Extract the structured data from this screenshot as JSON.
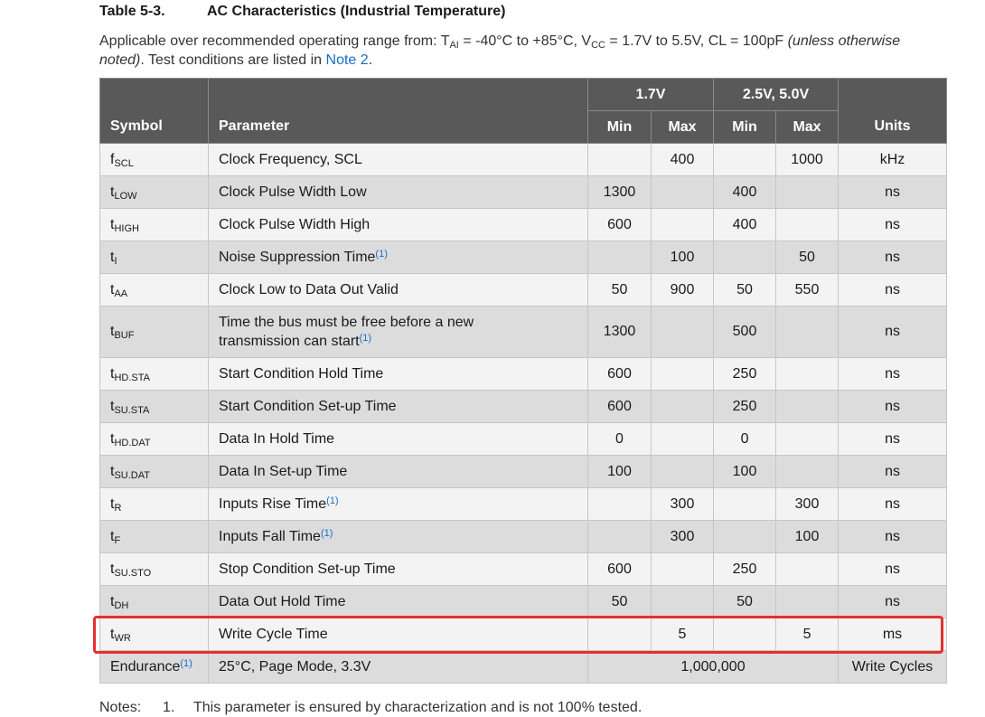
{
  "caption": {
    "number": "Table 5-3.",
    "title": "AC Characteristics (Industrial Temperature)"
  },
  "intro": {
    "p1": "Applicable over recommended operating range from: T",
    "ta_sub": "AI",
    "p2": " = -40°C to +85°C, V",
    "vcc_sub": "CC",
    "p3": " = 1.7V to 5.5V, CL = 100pF ",
    "italic": "(unless otherwise noted)",
    "p4": ". Test conditions are listed in ",
    "link": "Note 2",
    "p5": "."
  },
  "header": {
    "symbol": "Symbol",
    "parameter": "Parameter",
    "group1": "1.7V",
    "group2": "2.5V, 5.0V",
    "min": "Min",
    "max": "Max",
    "units": "Units"
  },
  "rows": [
    {
      "sym": "f",
      "sub": "SCL",
      "param": "Clock Frequency, SCL",
      "note": "",
      "min1": "",
      "max1": "400",
      "min2": "",
      "max2": "1000",
      "units": "kHz"
    },
    {
      "sym": "t",
      "sub": "LOW",
      "param": "Clock Pulse Width Low",
      "note": "",
      "min1": "1300",
      "max1": "",
      "min2": "400",
      "max2": "",
      "units": "ns"
    },
    {
      "sym": "t",
      "sub": "HIGH",
      "param": "Clock Pulse Width High",
      "note": "",
      "min1": "600",
      "max1": "",
      "min2": "400",
      "max2": "",
      "units": "ns"
    },
    {
      "sym": "t",
      "sub": "I",
      "param": "Noise Suppression Time",
      "note": "(1)",
      "min1": "",
      "max1": "100",
      "min2": "",
      "max2": "50",
      "units": "ns"
    },
    {
      "sym": "t",
      "sub": "AA",
      "param": "Clock Low to Data Out Valid",
      "note": "",
      "min1": "50",
      "max1": "900",
      "min2": "50",
      "max2": "550",
      "units": "ns"
    },
    {
      "sym": "t",
      "sub": "BUF",
      "param_line1": "Time the bus must be free before a new",
      "param": "transmission can start",
      "note": "(1)",
      "min1": "1300",
      "max1": "",
      "min2": "500",
      "max2": "",
      "units": "ns"
    },
    {
      "sym": "t",
      "sub": "HD.STA",
      "param": "Start Condition Hold Time",
      "note": "",
      "min1": "600",
      "max1": "",
      "min2": "250",
      "max2": "",
      "units": "ns"
    },
    {
      "sym": "t",
      "sub": "SU.STA",
      "param": "Start Condition Set-up Time",
      "note": "",
      "min1": "600",
      "max1": "",
      "min2": "250",
      "max2": "",
      "units": "ns"
    },
    {
      "sym": "t",
      "sub": "HD.DAT",
      "param": "Data In Hold Time",
      "note": "",
      "min1": "0",
      "max1": "",
      "min2": "0",
      "max2": "",
      "units": "ns"
    },
    {
      "sym": "t",
      "sub": "SU.DAT",
      "param": "Data In Set-up Time",
      "note": "",
      "min1": "100",
      "max1": "",
      "min2": "100",
      "max2": "",
      "units": "ns"
    },
    {
      "sym": "t",
      "sub": "R",
      "param": "Inputs Rise Time",
      "note": "(1)",
      "min1": "",
      "max1": "300",
      "min2": "",
      "max2": "300",
      "units": "ns"
    },
    {
      "sym": "t",
      "sub": "F",
      "param": "Inputs Fall Time",
      "note": "(1)",
      "min1": "",
      "max1": "300",
      "min2": "",
      "max2": "100",
      "units": "ns"
    },
    {
      "sym": "t",
      "sub": "SU.STO",
      "param": "Stop Condition Set-up Time",
      "note": "",
      "min1": "600",
      "max1": "",
      "min2": "250",
      "max2": "",
      "units": "ns"
    },
    {
      "sym": "t",
      "sub": "DH",
      "param": "Data Out Hold Time",
      "note": "",
      "min1": "50",
      "max1": "",
      "min2": "50",
      "max2": "",
      "units": "ns"
    },
    {
      "sym": "t",
      "sub": "WR",
      "param": "Write Cycle Time",
      "note": "",
      "min1": "",
      "max1": "5",
      "min2": "",
      "max2": "5",
      "units": "ms"
    }
  ],
  "endurance": {
    "label": "Endurance",
    "note": "(1)",
    "param": "25°C, Page Mode, 3.3V",
    "value": "1,000,000",
    "units": "Write Cycles"
  },
  "notes": {
    "label": "Notes:",
    "number": "1.",
    "text": "This parameter is ensured by characterization and is not 100% tested."
  },
  "colors": {
    "header_bg": "#595959",
    "row_dark": "#dcdcdc",
    "row_light": "#f3f3f3",
    "highlight": "#e33030",
    "link": "#1a6dc4"
  }
}
